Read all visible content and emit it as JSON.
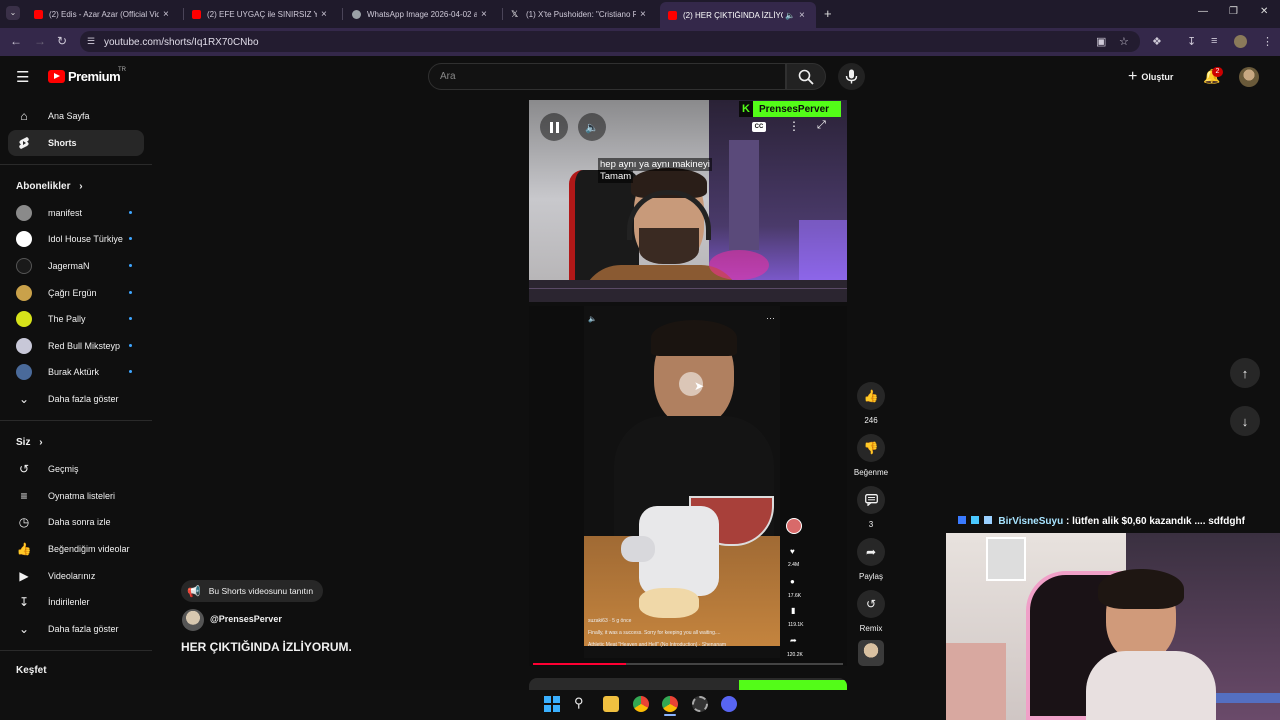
{
  "browser": {
    "tabs": [
      {
        "title": "(2) Edis - Azar Azar (Official Vid",
        "favicon_color": "#ff0000"
      },
      {
        "title": "(2) EFE UYGAÇ ile SINIRSIZ YEM",
        "favicon_color": "#ff0000"
      },
      {
        "title": "WhatsApp Image 2026-04-02 a",
        "favicon_color": "#9aa0a6"
      },
      {
        "title": "(1) X'te Pushoiden: \"Cristiano R",
        "favicon_color": "#ffffff"
      },
      {
        "title": "(2) HER ÇIKTIĞINDA İZLİYO",
        "favicon_color": "#ff0000"
      }
    ],
    "new_tab": "+",
    "url": "youtube.com/shorts/Iq1RX70CNbo"
  },
  "header": {
    "logo_text": "Premium",
    "logo_country": "TR",
    "search_placeholder": "Ara",
    "create_label": "Oluştur",
    "notification_count": "2"
  },
  "sidebar": {
    "main": [
      {
        "label": "Ana Sayfa",
        "icon": "home-icon"
      },
      {
        "label": "Shorts",
        "icon": "shorts-icon"
      }
    ],
    "subscriptions_heading": "Abonelikler",
    "subscriptions": [
      {
        "label": "manifest",
        "color": "#8a8a8a"
      },
      {
        "label": "Idol House Türkiye",
        "color": "#ffffff"
      },
      {
        "label": "JagermaN",
        "color": "#1a1a1a"
      },
      {
        "label": "Çağrı Ergün",
        "color": "#c9a14a"
      },
      {
        "label": "The Pally",
        "color": "#d6e21a"
      },
      {
        "label": "Red Bull Miksteyp",
        "color": "#c8c8d8"
      },
      {
        "label": "Burak Aktürk",
        "color": "#4a6a9a"
      }
    ],
    "subscriptions_more": "Daha fazla göster",
    "you_heading": "Siz",
    "you_items": [
      {
        "label": "Geçmiş",
        "icon": "history-icon"
      },
      {
        "label": "Oynatma listeleri",
        "icon": "playlist-icon"
      },
      {
        "label": "Daha sonra izle",
        "icon": "clock-icon"
      },
      {
        "label": "Beğendiğim videolar",
        "icon": "thumb-up-icon"
      },
      {
        "label": "Videolarınız",
        "icon": "video-icon"
      },
      {
        "label": "İndirilenler",
        "icon": "download-icon"
      }
    ],
    "you_more": "Daha fazla göster",
    "explore_heading": "Keşfet"
  },
  "short": {
    "top_channel_overlay": "PrensesPerver",
    "caption_line1": "hep aynı ya aynı makineyi",
    "caption_line2": "Tamam",
    "promote_label": "Bu Shorts videosunu tanıtın",
    "channel": "@PrensesPerver",
    "title": "HER ÇIKTIĞINDA İZLİYORUM.",
    "likes": "246",
    "dislike_label": "Beğenme",
    "comments": "3",
    "share_label": "Paylaş",
    "remix_label": "Remix",
    "inner_caption": "Finally, it was a success. Sorry for keeping you all waiting....",
    "inner_song": "Athletic Meat \"Heaven and Hell\" (No Introduction) · Shenanam",
    "inner_user": "suzaki63 · 5 g önce",
    "inner_likes": "2.4M",
    "inner_comments": "17.6K",
    "inner_saves": "119.1K",
    "inner_shares": "120.2K"
  },
  "stream": {
    "chat_user": "BirVisneSuyu",
    "chat_message": ": lütfen alik $0,60 kazandık .... sdfdghf"
  }
}
